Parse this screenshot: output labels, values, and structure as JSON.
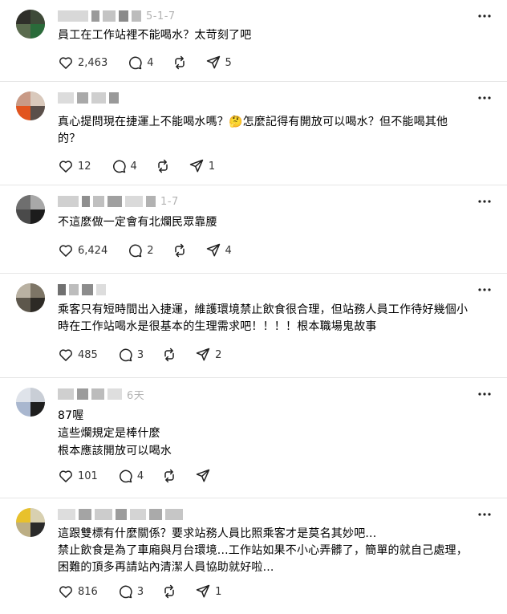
{
  "posts": [
    {
      "date_fragment": "5-1-7",
      "text_lines": [
        "員工在工作站裡不能喝水？太苛刻了吧"
      ],
      "likes": "2,463",
      "replies": "4",
      "reposts": "",
      "shares": "5"
    },
    {
      "date_fragment": "",
      "text_lines": [
        "真心提問現在捷運上不能喝水嗎？🤔怎麼記得有開放可以喝水？但不能喝其他",
        "的？"
      ],
      "likes": "12",
      "replies": "4",
      "reposts": "",
      "shares": "1"
    },
    {
      "date_fragment": "1-7",
      "text_lines": [
        "不這麼做一定會有北爛民眾靠腰"
      ],
      "likes": "6,424",
      "replies": "2",
      "reposts": "",
      "shares": "4"
    },
    {
      "date_fragment": "",
      "text_lines": [
        "乘客只有短時間出入捷運，維護環境禁止飲食很合理，但站務人員工作待好幾個小",
        "時在工作站喝水是很基本的生理需求吧！！！！根本職場鬼故事"
      ],
      "likes": "485",
      "replies": "3",
      "reposts": "",
      "shares": "2"
    },
    {
      "date_fragment": "6天",
      "text_lines": [
        "87喔",
        "這些爛規定是棒什麼",
        "根本應該開放可以喝水"
      ],
      "likes": "101",
      "replies": "4",
      "reposts": "",
      "shares": ""
    },
    {
      "date_fragment": "",
      "text_lines": [
        "這跟雙標有什麼關係？要求站務人員比照乘客才是莫名其妙吧...",
        "禁止飲食是為了車廂與月台環境...工作站如果不小心弄髒了，簡單的就自己處理，",
        "困難的頂多再請站內清潔人員協助就好啦..."
      ],
      "likes": "816",
      "replies": "3",
      "reposts": "",
      "shares": "1"
    }
  ],
  "icons": {
    "like": "heart-icon",
    "reply": "comment-icon",
    "repost": "repost-icon",
    "share": "send-icon",
    "more": "more-icon"
  },
  "colors": {
    "text": "#000000",
    "count": "#333333",
    "icon": "#1f1f1f",
    "divider": "#e6e6e6",
    "date": "#9a9a9a"
  }
}
